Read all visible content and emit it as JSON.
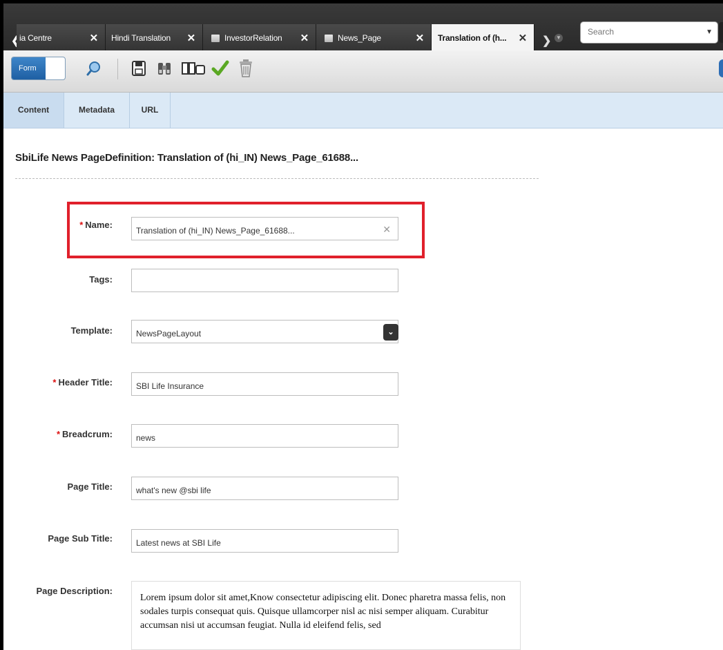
{
  "tabs": [
    {
      "label": "ia Centre",
      "close": "✕"
    },
    {
      "label": "Hindi Translation",
      "close": "✕"
    },
    {
      "label": "InvestorRelation",
      "close": "✕"
    },
    {
      "label": "News_Page",
      "close": "✕"
    },
    {
      "label": "Translation of (h...",
      "close": "✕",
      "active": true
    }
  ],
  "search": {
    "placeholder": "Search"
  },
  "toolbar": {
    "mode_label": "Form"
  },
  "subtabs": [
    {
      "label": "Content",
      "active": true
    },
    {
      "label": "Metadata"
    },
    {
      "label": "URL"
    }
  ],
  "page": {
    "heading": "SbiLife News PageDefinition: Translation of (hi_IN) News_Page_61688..."
  },
  "form": {
    "name": {
      "label": "Name:",
      "required": "*",
      "value": "Translation of (hi_IN) News_Page_61688..."
    },
    "tags": {
      "label": "Tags:",
      "value": ""
    },
    "template": {
      "label": "Template:",
      "value": "NewsPageLayout"
    },
    "header_title": {
      "label": "Header Title:",
      "required": "*",
      "value": "SBI Life Insurance"
    },
    "breadcrum": {
      "label": "Breadcrum:",
      "required": "*",
      "value": "news"
    },
    "page_title": {
      "label": "Page Title:",
      "value": "what's new @sbi life"
    },
    "page_sub_title": {
      "label": "Page Sub Title:",
      "value": "Latest news at SBI Life"
    },
    "page_description": {
      "label": "Page Description:",
      "value": "Lorem ipsum dolor sit amet,Know consectetur adipiscing elit. Donec pharetra massa felis, non sodales turpis consequat quis. Quisque ullamcorper nisl ac nisi semper aliquam. Curabitur accumsan nisi ut accumsan feugiat. Nulla id eleifend felis, sed"
    }
  },
  "colors": {
    "accent": "#1e5fa3",
    "highlight": "#e0202b",
    "required": "#dd1111"
  }
}
